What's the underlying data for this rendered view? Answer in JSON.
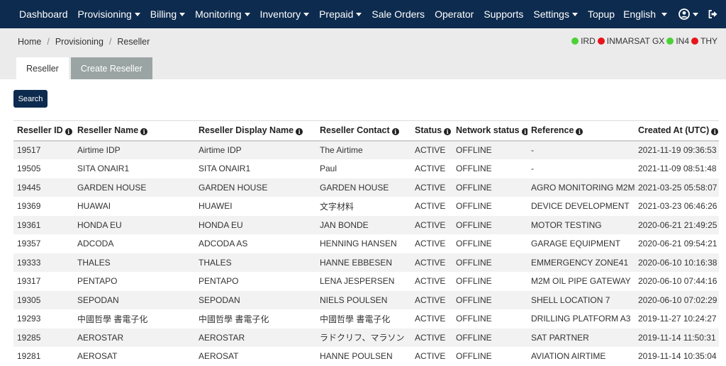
{
  "nav": {
    "items": [
      {
        "label": "Dashboard",
        "caret": false
      },
      {
        "label": "Provisioning",
        "caret": true
      },
      {
        "label": "Billing",
        "caret": true
      },
      {
        "label": "Monitoring",
        "caret": true
      },
      {
        "label": "Inventory",
        "caret": true
      },
      {
        "label": "Prepaid",
        "caret": true
      },
      {
        "label": "Sale Orders",
        "caret": false
      },
      {
        "label": "Operator",
        "caret": false
      },
      {
        "label": "Supports",
        "caret": false
      },
      {
        "label": "Settings",
        "caret": true
      },
      {
        "label": "Topup",
        "caret": false
      }
    ],
    "language": "English",
    "user_icon": "user-circle-icon",
    "logout_icon": "sign-out-icon"
  },
  "breadcrumb": [
    "Home",
    "Provisioning",
    "Reseller"
  ],
  "status_legend": [
    {
      "label": "IRD",
      "color": "#4cd137"
    },
    {
      "label": "INMARSAT GX",
      "color": "#e8141c"
    },
    {
      "label": "IN4",
      "color": "#4cd137"
    },
    {
      "label": "THY",
      "color": "#e8141c"
    }
  ],
  "tabs": [
    {
      "label": "Reseller",
      "active": true
    },
    {
      "label": "Create Reseller",
      "active": false
    }
  ],
  "search_label": "Search",
  "table": {
    "columns": [
      "Reseller ID",
      "Reseller Name",
      "Reseller Display Name",
      "Reseller Contact",
      "Status",
      "Network status",
      "Reference",
      "Created At (UTC)"
    ],
    "rows": [
      [
        "19517",
        "Airtime IDP",
        "Airtime IDP",
        "The Airtime",
        "ACTIVE",
        "OFFLINE",
        "-",
        "2021-11-19 09:36:53"
      ],
      [
        "19505",
        "SITA ONAIR1",
        "SITA ONAIR1",
        "Paul",
        "ACTIVE",
        "OFFLINE",
        "-",
        "2021-11-09 08:51:48"
      ],
      [
        "19445",
        "GARDEN HOUSE",
        "GARDEN HOUSE",
        "GARDEN HOUSE",
        "ACTIVE",
        "OFFLINE",
        "AGRO MONITORING M2M",
        "2021-03-25 05:58:07"
      ],
      [
        "19369",
        "HUAWAI",
        "HUAWEI",
        "文字材料",
        "ACTIVE",
        "OFFLINE",
        "DEVICE DEVELOPMENT",
        "2021-03-23 06:46:26"
      ],
      [
        "19361",
        "HONDA EU",
        "HONDA EU",
        "JAN BONDE",
        "ACTIVE",
        "OFFLINE",
        "MOTOR TESTING",
        "2020-06-21 21:49:25"
      ],
      [
        "19357",
        "ADCODA",
        "ADCODA AS",
        "HENNING HANSEN",
        "ACTIVE",
        "OFFLINE",
        "GARAGE EQUIPMENT",
        "2020-06-21 09:54:21"
      ],
      [
        "19333",
        "THALES",
        "THALES",
        "HANNE EBBESEN",
        "ACTIVE",
        "OFFLINE",
        "EMMERGENCY ZONE41",
        "2020-06-10 10:16:38"
      ],
      [
        "19317",
        "PENTAPO",
        "PENTAPO",
        "LENA JESPERSEN",
        "ACTIVE",
        "OFFLINE",
        "M2M OIL PIPE GATEWAY",
        "2020-06-10 07:44:16"
      ],
      [
        "19305",
        "SEPODAN",
        "SEPODAN",
        "NIELS POULSEN",
        "ACTIVE",
        "OFFLINE",
        "SHELL LOCATION 7",
        "2020-06-10 07:02:29"
      ],
      [
        "19293",
        "中國哲學 書電子化",
        "中國哲學 書電子化",
        "中國哲學 書電子化",
        "ACTIVE",
        "OFFLINE",
        "DRILLING PLATFORM A3",
        "2019-11-27 10:24:27"
      ],
      [
        "19285",
        "AEROSTAR",
        "AEROSTAR",
        "ラドクリフ、マラソン",
        "ACTIVE",
        "OFFLINE",
        "SAT PARTNER",
        "2019-11-14 11:50:31"
      ],
      [
        "19281",
        "AEROSAT",
        "AEROSAT",
        "HANNE POULSEN",
        "ACTIVE",
        "OFFLINE",
        "AVIATION AIRTIME",
        "2019-11-14 10:35:04"
      ]
    ]
  }
}
